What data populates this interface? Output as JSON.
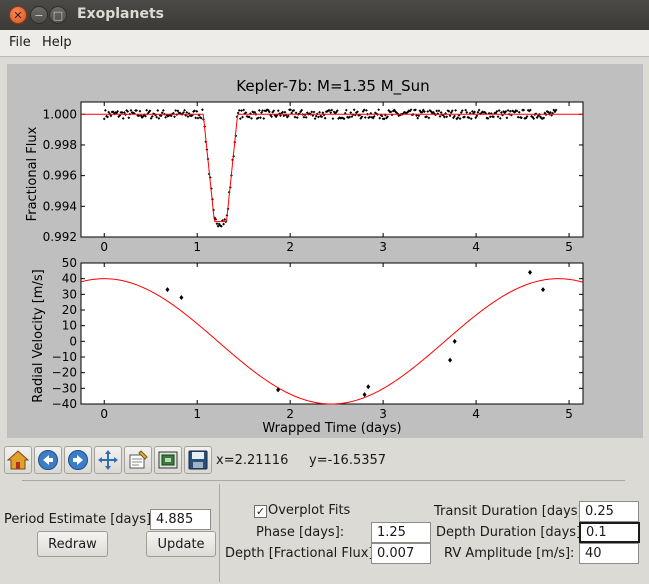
{
  "window": {
    "title": "Exoplanets"
  },
  "menu": {
    "file": "File",
    "help": "Help"
  },
  "chart_data": [
    {
      "type": "scatter",
      "title": "Kepler-7b: M=1.35 M_Sun",
      "xlabel": "",
      "ylabel": "Fractional Flux",
      "xlim": [
        -0.25,
        5.15
      ],
      "ylim": [
        0.992,
        1.0008
      ],
      "xticks": [
        "0",
        "1",
        "2",
        "3",
        "4",
        "5"
      ],
      "yticks": [
        "1.000",
        "0.998",
        "0.996",
        "0.994",
        "0.992"
      ],
      "series": [
        {
          "style": "points",
          "note": "dense observations near 1.000 plus transit dip",
          "dip_center": 1.25,
          "dip_depth_min": 0.9926
        },
        {
          "style": "model-line",
          "color": "#ff0000",
          "depth": 0.007,
          "duration": 0.25,
          "center": 1.25
        }
      ]
    },
    {
      "type": "scatter",
      "title": "",
      "xlabel": "Wrapped Time (days)",
      "ylabel": "Radial Velocity [m/s]",
      "xlim": [
        -0.25,
        5.15
      ],
      "ylim": [
        -40,
        50
      ],
      "xticks": [
        "0",
        "1",
        "2",
        "3",
        "4",
        "5"
      ],
      "yticks": [
        "50",
        "40",
        "30",
        "20",
        "10",
        "0",
        "−10",
        "−20",
        "−30",
        "−40"
      ],
      "series": [
        {
          "style": "points",
          "x": [
            0.68,
            0.83,
            1.87,
            2.8,
            2.84,
            3.72,
            3.77,
            4.58,
            4.72
          ],
          "y": [
            33,
            28,
            -31,
            -34,
            -29,
            -12,
            0,
            44,
            33
          ]
        },
        {
          "style": "model-line",
          "color": "#ff0000",
          "amplitude": 40,
          "period": 4.885,
          "phase": 1.25
        }
      ]
    }
  ],
  "toolbar": {
    "icons": [
      "home-icon",
      "back-icon",
      "forward-icon",
      "pan-icon",
      "configure-icon",
      "zoom-rect-icon",
      "save-icon"
    ],
    "x_readout": "x=2.21116",
    "y_readout": "y=-16.5357"
  },
  "controls": {
    "period_label": "Period Estimate [days]:",
    "period_value": "4.885",
    "redraw": "Redraw",
    "update": "Update",
    "overplot_label": "Overplot Fits",
    "overplot_checked": true,
    "phase_label": "Phase [days]:",
    "phase_value": "1.25",
    "depth_label": "Depth [Fractional Flux]:",
    "depth_value": "0.007",
    "transit_duration_label": "Transit Duration [days]:",
    "transit_duration_value": "0.25",
    "depth_duration_label": "Depth Duration [days]:",
    "depth_duration_value": "0.1",
    "rv_amplitude_label": "RV Amplitude [m/s]:",
    "rv_amplitude_value": "40"
  }
}
